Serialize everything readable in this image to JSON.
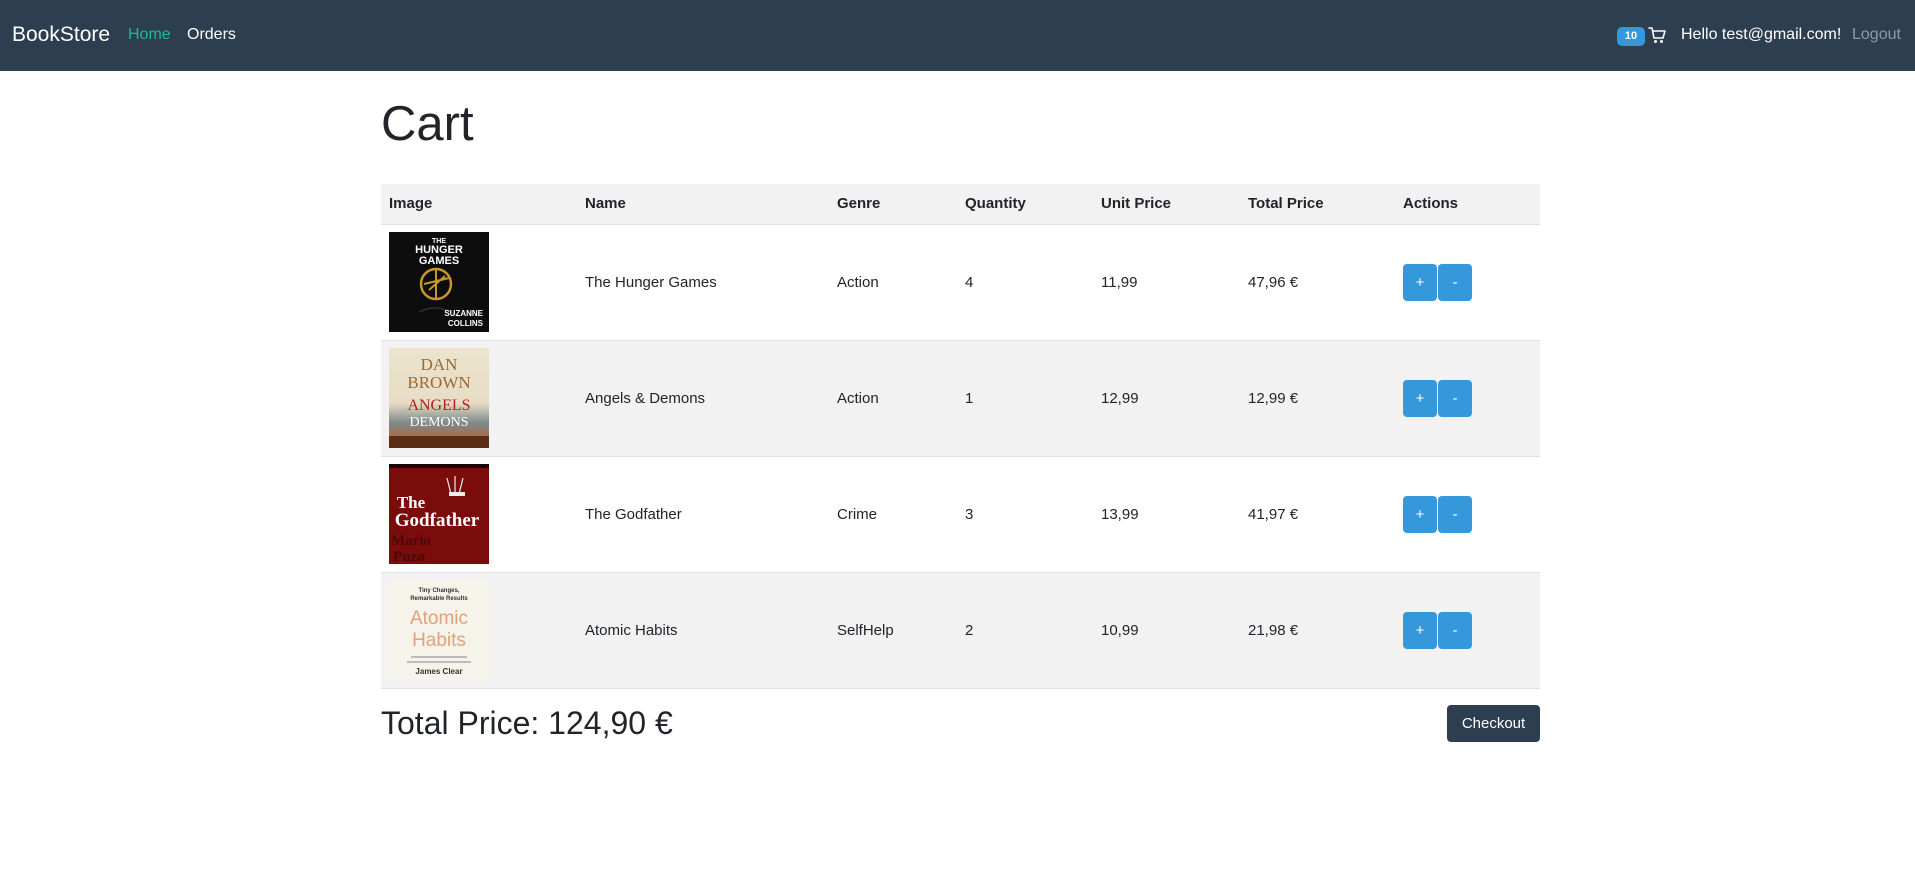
{
  "navbar": {
    "brand": "BookStore",
    "links": [
      "Home",
      "Orders"
    ],
    "cart_count": "10",
    "cart_icon": "cart-icon",
    "greeting": "Hello test@gmail.com!",
    "logout": "Logout",
    "colors": {
      "background": "#2c3e50",
      "active_link": "#18bc9c",
      "badge": "#3498db"
    }
  },
  "page": {
    "title": "Cart"
  },
  "table": {
    "headers": [
      "Image",
      "Name",
      "Genre",
      "Quantity",
      "Unit Price",
      "Total Price",
      "Actions"
    ],
    "rows": [
      {
        "cover_title": [
          "THE",
          "HUNGER",
          "GAMES"
        ],
        "cover_author": [
          "SUZANNE",
          "COLLINS"
        ],
        "name": "The Hunger Games",
        "genre": "Action",
        "quantity": "4",
        "unit_price": "11,99",
        "total_price": "47,96 €",
        "plus": "+",
        "minus": "-"
      },
      {
        "cover_author": [
          "DAN",
          "BROWN"
        ],
        "cover_title": [
          "ANGELS",
          "DEMONS"
        ],
        "name": "Angels & Demons",
        "genre": "Action",
        "quantity": "1",
        "unit_price": "12,99",
        "total_price": "12,99 €",
        "plus": "+",
        "minus": "-"
      },
      {
        "cover_title": [
          "The",
          "Godfather"
        ],
        "cover_author": [
          "Mario",
          "Puzo"
        ],
        "name": "The Godfather",
        "genre": "Crime",
        "quantity": "3",
        "unit_price": "13,99",
        "total_price": "41,97 €",
        "plus": "+",
        "minus": "-"
      },
      {
        "cover_subtitle": [
          "Tiny Changes,",
          "Remarkable Results"
        ],
        "cover_title": [
          "Atomic",
          "Habits"
        ],
        "cover_author": [
          "James Clear"
        ],
        "name": "Atomic Habits",
        "genre": "SelfHelp",
        "quantity": "2",
        "unit_price": "10,99",
        "total_price": "21,98 €",
        "plus": "+",
        "minus": "-"
      }
    ]
  },
  "summary": {
    "total_price": "Total Price: 124,90 €",
    "checkout": "Checkout"
  },
  "colors": {
    "primary_button": "#3498db",
    "checkout_button": "#2c3e50",
    "striped_row": "#f2f2f2"
  }
}
